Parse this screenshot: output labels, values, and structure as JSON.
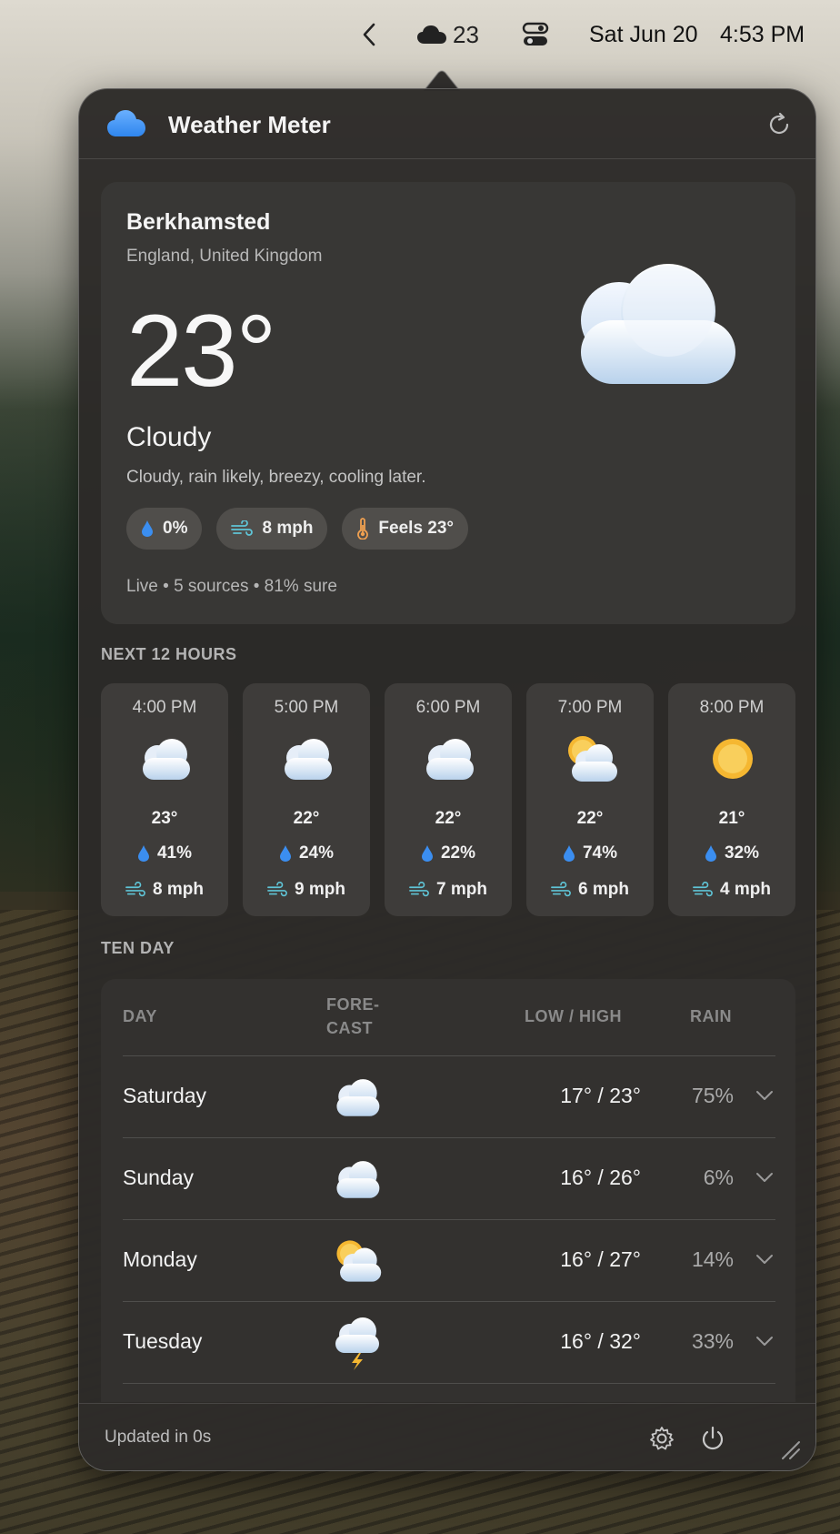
{
  "menubar": {
    "weather_temp": "23",
    "date": "Sat Jun 20",
    "time": "4:53 PM"
  },
  "app": {
    "title": "Weather Meter",
    "icons": {
      "logo": "cloud-icon",
      "refresh": "refresh-icon"
    }
  },
  "current": {
    "city": "Berkhamsted",
    "region": "England, United Kingdom",
    "temp": "23°",
    "condition": "Cloudy",
    "description": "Cloudy, rain likely, breezy, cooling later.",
    "precip": "0%",
    "wind": "8 mph",
    "feels": "Feels 23°",
    "meta": "Live • 5 sources • 81% sure"
  },
  "hourly": {
    "label": "NEXT 12 HOURS",
    "items": [
      {
        "time": "4:00 PM",
        "icon": "cloudy",
        "temp": "23°",
        "precip": "41%",
        "wind": "8 mph"
      },
      {
        "time": "5:00 PM",
        "icon": "cloudy",
        "temp": "22°",
        "precip": "24%",
        "wind": "9 mph"
      },
      {
        "time": "6:00 PM",
        "icon": "cloudy",
        "temp": "22°",
        "precip": "22%",
        "wind": "7 mph"
      },
      {
        "time": "7:00 PM",
        "icon": "partly-cloudy",
        "temp": "22°",
        "precip": "74%",
        "wind": "6 mph"
      },
      {
        "time": "8:00 PM",
        "icon": "sunny",
        "temp": "21°",
        "precip": "32%",
        "wind": "4 mph"
      }
    ]
  },
  "tenday": {
    "label": "TEN DAY",
    "headers": {
      "day": "DAY",
      "forecast_1": "FORE-",
      "forecast_2": "CAST",
      "lowhigh": "LOW / HIGH",
      "rain": "RAIN"
    },
    "rows": [
      {
        "day": "Saturday",
        "icon": "cloudy",
        "lowhigh": "17° / 23°",
        "rain": "75%"
      },
      {
        "day": "Sunday",
        "icon": "cloudy",
        "lowhigh": "16° / 26°",
        "rain": "6%"
      },
      {
        "day": "Monday",
        "icon": "partly-cloudy",
        "lowhigh": "16° / 27°",
        "rain": "14%"
      },
      {
        "day": "Tuesday",
        "icon": "thunderstorm",
        "lowhigh": "16° / 32°",
        "rain": "33%"
      }
    ]
  },
  "footer": {
    "updated": "Updated in 0s"
  },
  "colors": {
    "accent_blue": "#3b8ef0",
    "wind_teal": "#5fc4d6",
    "sun": "#f5b731",
    "panel": "#2c2a28"
  }
}
